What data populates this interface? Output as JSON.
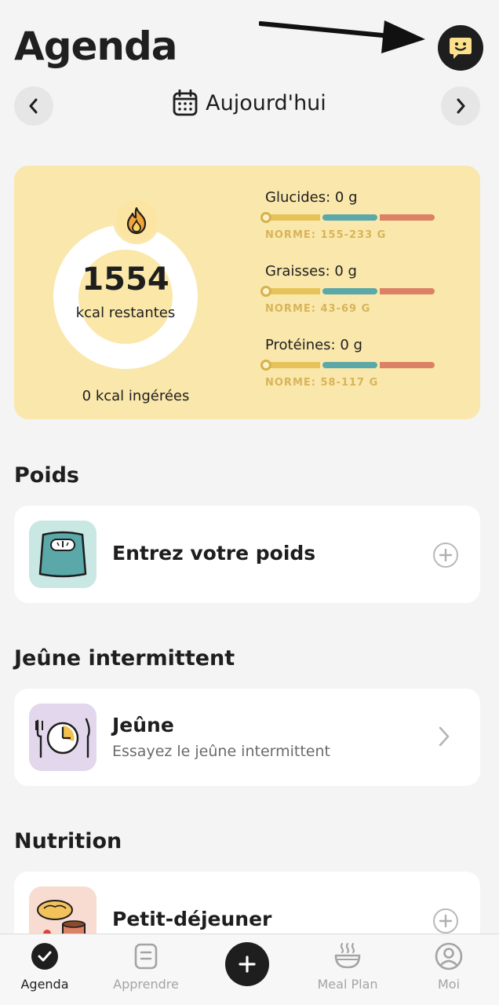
{
  "header": {
    "title": "Agenda"
  },
  "date_nav": {
    "label": "Aujourd'hui"
  },
  "summary": {
    "kcal_remaining": "1554",
    "kcal_remaining_label": "kcal restantes",
    "kcal_eaten": "0 kcal ingérées",
    "macros": [
      {
        "label": "Glucides: 0 g",
        "norm": "NORME: 155-233 G",
        "progress": 0
      },
      {
        "label": "Graisses: 0 g",
        "norm": "NORME: 43-69 G",
        "progress": 0
      },
      {
        "label": "Protéines: 0 g",
        "norm": "NORME: 58-117 G",
        "progress": 0
      }
    ],
    "colors": {
      "card": "#fae7ab",
      "bar_low": "#e6c35a",
      "bar_mid": "#5aa8a7",
      "bar_high": "#db8266"
    }
  },
  "sections": {
    "weight": {
      "title": "Poids",
      "card_title": "Entrez votre poids"
    },
    "fasting": {
      "title": "Jeûne intermittent",
      "card_title": "Jeûne",
      "card_subtitle": "Essayez le jeûne intermittent"
    },
    "nutrition": {
      "title": "Nutrition",
      "card_title": "Petit-déjeuner"
    }
  },
  "tabbar": {
    "tabs": [
      {
        "label": "Agenda",
        "icon": "check-circle-icon",
        "active": true
      },
      {
        "label": "Apprendre",
        "icon": "note-icon",
        "active": false
      },
      {
        "label": "",
        "icon": "plus-icon",
        "active": false
      },
      {
        "label": "Meal Plan",
        "icon": "bowl-icon",
        "active": false
      },
      {
        "label": "Moi",
        "icon": "profile-icon",
        "active": false
      }
    ]
  }
}
